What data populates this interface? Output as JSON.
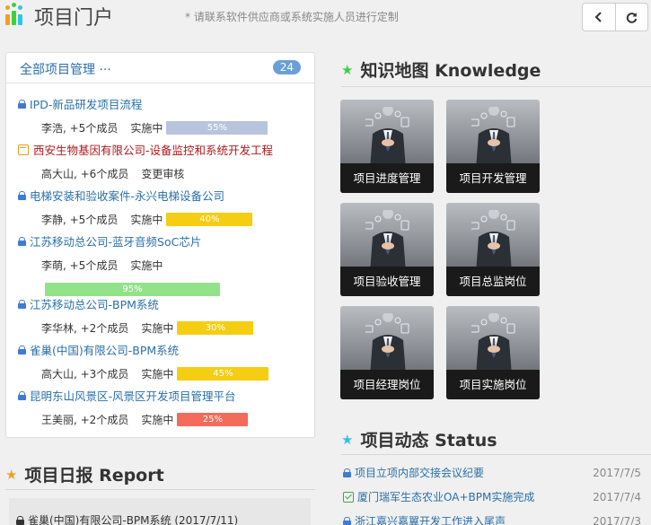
{
  "header": {
    "title": "项目门户",
    "note": "* 请联系软件供应商或系统实施人员进行定制",
    "back_icon": "chevron-left-icon",
    "refresh_icon": "refresh-icon"
  },
  "projects_panel": {
    "title": "全部项目管理 ···",
    "count": "24",
    "items": [
      {
        "title": "IPD-新品研发项目流程",
        "members": "李浩, +5个成员",
        "status": "实施中",
        "progress": 0.55,
        "progress_label": "55%",
        "bar_color": "#b7c4dc",
        "icon": "lock-icon"
      },
      {
        "title": "西安生物基因有限公司-设备监控和系统开发工程",
        "members": "高大山, +6个成员",
        "status": "变更审核",
        "progress": null,
        "progress_label": "",
        "bar_color": "",
        "icon": "calendar-icon"
      },
      {
        "title": "电梯安装和验收案件-永兴电梯设备公司",
        "members": "李静, +5个成员",
        "status": "实施中",
        "progress": 0.4,
        "progress_label": "40%",
        "bar_color": "#f5cd12",
        "icon": "lock-icon"
      },
      {
        "title": "江苏移动总公司-蓝牙音频SoC芯片",
        "members": "李萌, +5个成员",
        "status": "实施中",
        "progress": 0.95,
        "progress_label": "95%",
        "bar_color": "#92e28a",
        "icon": "lock-icon"
      },
      {
        "title": "江苏移动总公司-BPM系统",
        "members": "李华林, +2个成员",
        "status": "实施中",
        "progress": 0.3,
        "progress_label": "30%",
        "bar_color": "#f5cd12",
        "icon": "lock-icon"
      },
      {
        "title": "雀巢(中国)有限公司-BPM系统",
        "members": "高大山, +3个成员",
        "status": "实施中",
        "progress": 0.45,
        "progress_label": "45%",
        "bar_color": "#f5cd12",
        "icon": "lock-icon"
      },
      {
        "title": "昆明东山风景区-风景区开发项目管理平台",
        "members": "王美丽, +2个成员",
        "status": "实施中",
        "progress": 0.25,
        "progress_label": "25%",
        "bar_color": "#f46a5b",
        "icon": "lock-icon"
      }
    ]
  },
  "knowledge": {
    "title": "知识地图 Knowledge",
    "star_color": "#3bd13b",
    "tiles": [
      "项目进度管理",
      "项目开发管理",
      "项目验收管理",
      "项目总监岗位",
      "项目经理岗位",
      "项目实施岗位"
    ]
  },
  "status": {
    "title": "项目动态 Status",
    "star_color": "#2ec4e8",
    "items": [
      {
        "text": "项目立项内部交接会议纪要",
        "date": "2017/7/5",
        "icon": "lock-icon"
      },
      {
        "text": "厦门瑞军生态农业OA+BPM实施完成",
        "date": "2017/7/4",
        "icon": "check-calendar-icon"
      },
      {
        "text": "浙江嘉兴嘉翼开发工作进入尾声",
        "date": "2017/7/3",
        "icon": "lock-icon"
      }
    ]
  },
  "report": {
    "title": "项目日报 Report",
    "star_color": "#f0a020",
    "items": [
      {
        "text": "雀巢(中国)有限公司-BPM系统 (2017/7/11)",
        "icon": "lock-icon"
      }
    ]
  }
}
